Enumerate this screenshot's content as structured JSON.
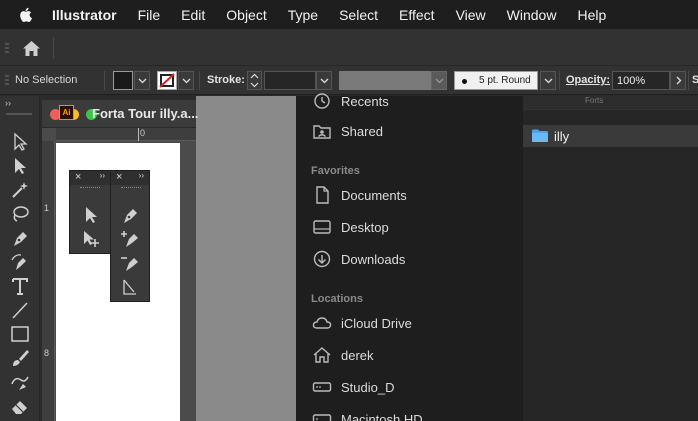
{
  "menubar": {
    "app": "Illustrator",
    "items": [
      "File",
      "Edit",
      "Object",
      "Type",
      "Select",
      "Effect",
      "View",
      "Window",
      "Help"
    ]
  },
  "control_bar": {
    "selection_status": "No Selection",
    "stroke_label": "Stroke:",
    "stroke_weight": "",
    "brush": "5 pt. Round",
    "opacity_label": "Opacity:",
    "opacity_value": "100%",
    "style_label": "S"
  },
  "document": {
    "title": "Forta Tour illy.a...",
    "file_badge": "Ai",
    "ruler_top_zero": "0",
    "ruler_left_1": "1",
    "ruler_left_8": "8"
  },
  "finder": {
    "items_top": [
      {
        "label": "Recents",
        "icon": "clock-icon"
      },
      {
        "label": "Shared",
        "icon": "shared-folder-icon"
      }
    ],
    "favorites_header": "Favorites",
    "favorites": [
      {
        "label": "Documents",
        "icon": "document-icon"
      },
      {
        "label": "Desktop",
        "icon": "desktop-icon"
      },
      {
        "label": "Downloads",
        "icon": "download-icon"
      }
    ],
    "locations_header": "Locations",
    "locations": [
      {
        "label": "iCloud Drive",
        "icon": "cloud-icon"
      },
      {
        "label": "derek",
        "icon": "home-icon"
      },
      {
        "label": "Studio_D",
        "icon": "drive-icon"
      },
      {
        "label": "Macintosh HD",
        "icon": "drive-icon"
      }
    ],
    "column_selected": "illy",
    "column_top": "Forts"
  },
  "colors": {
    "menubar_bg": "#1e1e1e",
    "panel_bg": "#323232",
    "finder_bg": "#1e1e1e",
    "folder_blue": "#4aa3f0"
  }
}
